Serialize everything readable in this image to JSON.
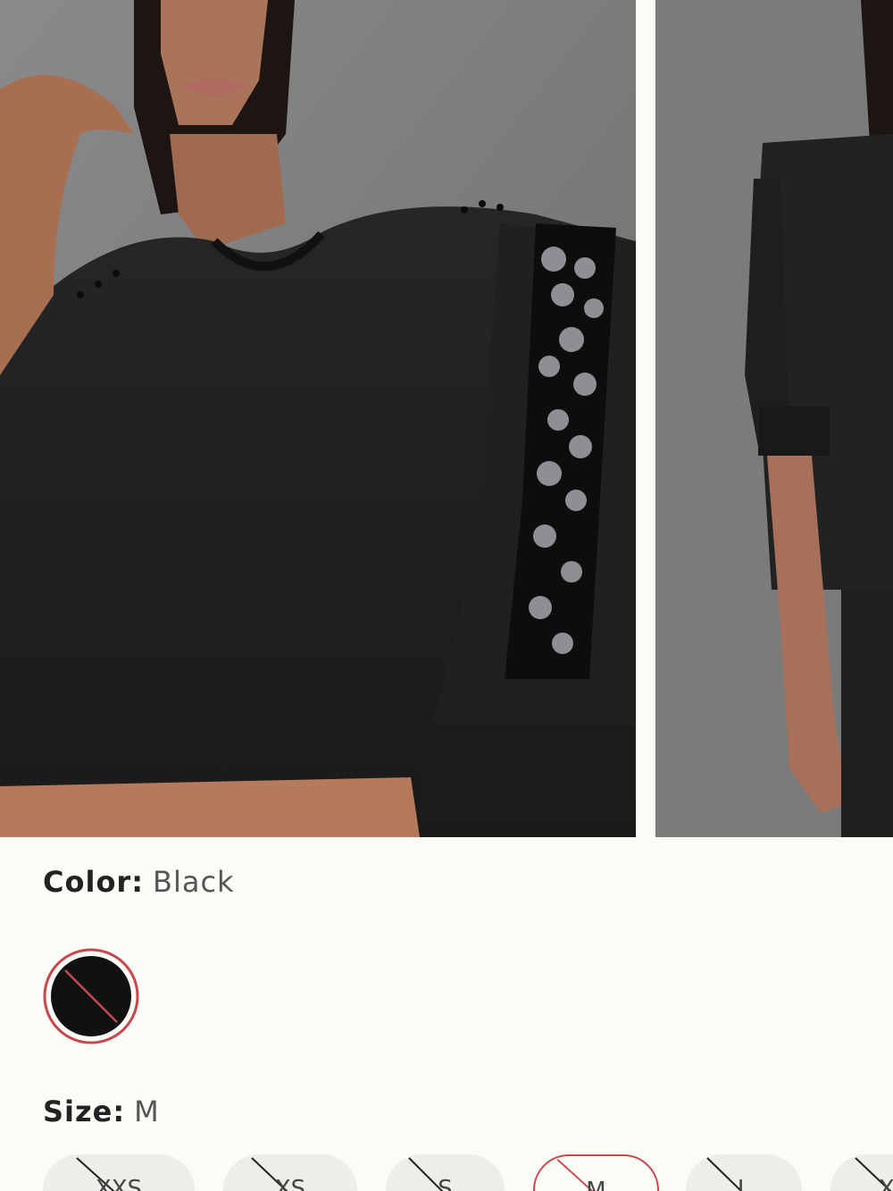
{
  "gallery": {
    "images": [
      {
        "alt": "",
        "icon": "product-front-photo"
      },
      {
        "alt": "",
        "icon": "product-back-photo"
      }
    ]
  },
  "color": {
    "label": "Color:",
    "value": "Black",
    "swatches": [
      {
        "name": "Black",
        "hex": "#111111",
        "available": false
      }
    ]
  },
  "size": {
    "label": "Size:",
    "value": "M",
    "options": [
      {
        "label": "XXS",
        "available": false
      },
      {
        "label": "XS",
        "available": false
      },
      {
        "label": "S",
        "available": false
      },
      {
        "label": "M",
        "available": false,
        "selected": true
      },
      {
        "label": "L",
        "available": false
      },
      {
        "label": "XL",
        "available": false
      }
    ]
  },
  "colors": {
    "background": "#fbfbf7",
    "accent": "#c9474a",
    "pill": "#eeede8"
  }
}
